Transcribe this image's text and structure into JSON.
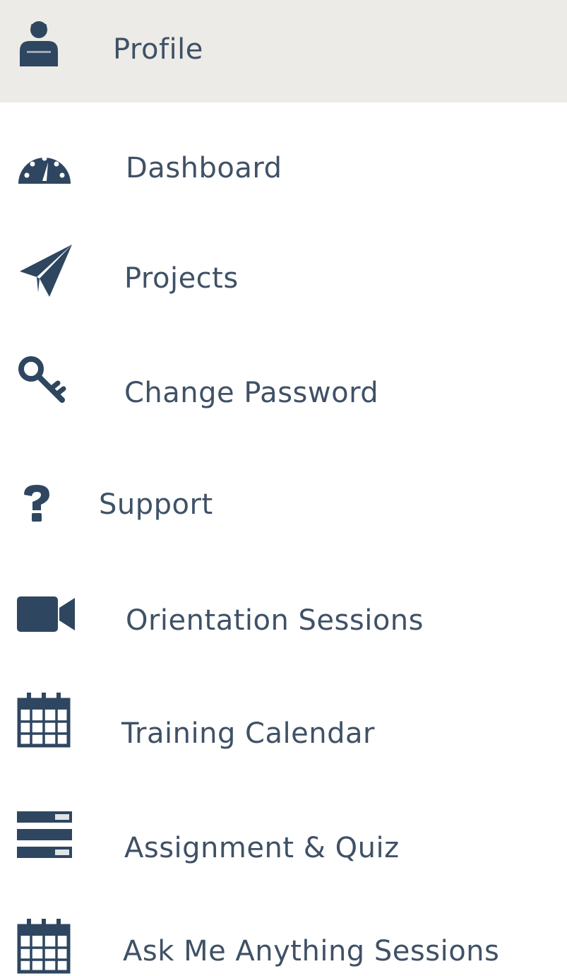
{
  "menu": {
    "items": [
      {
        "key": "profile",
        "label": "Profile",
        "icon": "user-icon",
        "active": true
      },
      {
        "key": "dashboard",
        "label": "Dashboard",
        "icon": "dashboard-icon"
      },
      {
        "key": "projects",
        "label": "Projects",
        "icon": "paper-plane-icon"
      },
      {
        "key": "change-password",
        "label": "Change Password",
        "icon": "key-icon"
      },
      {
        "key": "support",
        "label": "Support",
        "icon": "question-icon"
      },
      {
        "key": "orientation-sessions",
        "label": "Orientation Sessions",
        "icon": "video-camera-icon"
      },
      {
        "key": "training-calendar",
        "label": "Training Calendar",
        "icon": "calendar-icon"
      },
      {
        "key": "assignment-quiz",
        "label": "Assignment & Quiz",
        "icon": "list-icon"
      },
      {
        "key": "ask-me-anything",
        "label": "Ask Me Anything Sessions",
        "icon": "calendar-icon"
      }
    ]
  },
  "colors": {
    "icon": "#2e4660",
    "text": "#3f5166",
    "active_background": "#ecebe7"
  }
}
